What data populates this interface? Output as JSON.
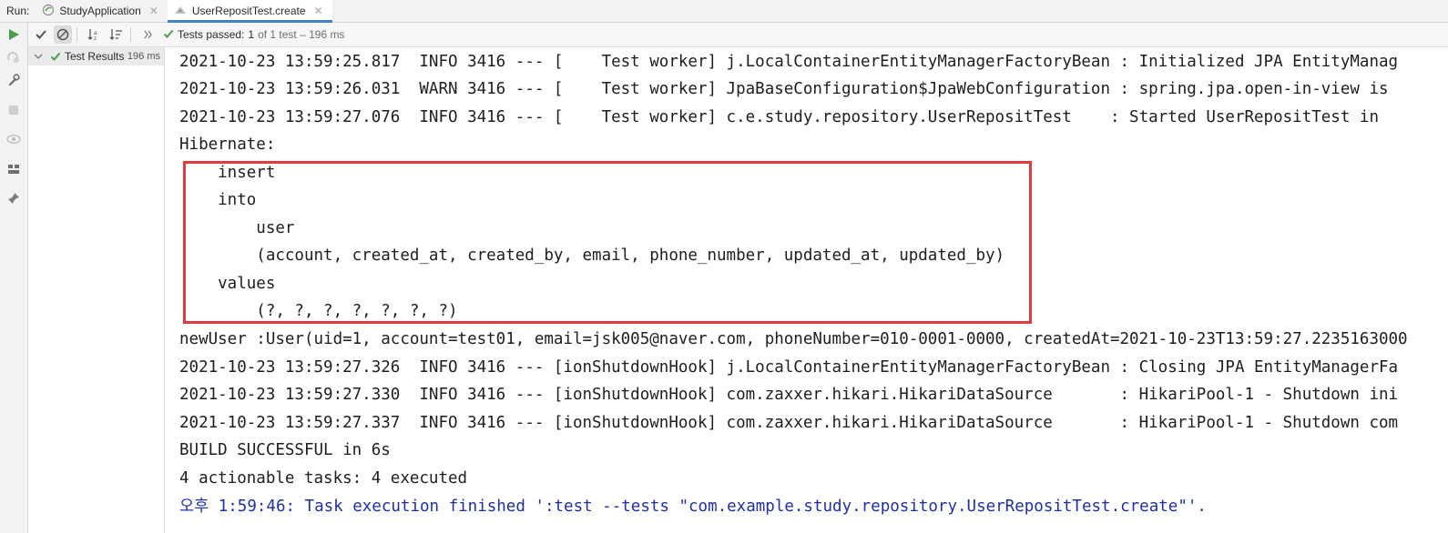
{
  "tabbar": {
    "run_label": "Run:",
    "tabs": [
      {
        "label": "StudyApplication"
      },
      {
        "label": "UserRepositTest.create"
      }
    ]
  },
  "toolbar": {
    "status_prefix": "Tests passed:",
    "status_count": "1",
    "status_detail": "of 1 test – 196 ms"
  },
  "tree": {
    "root": {
      "label": "Test Results",
      "time": "196 ms"
    }
  },
  "console": {
    "lines": [
      "2021-10-23 13:59:25.817  INFO 3416 --- [    Test worker] j.LocalContainerEntityManagerFactoryBean : Initialized JPA EntityManag",
      "2021-10-23 13:59:26.031  WARN 3416 --- [    Test worker] JpaBaseConfiguration$JpaWebConfiguration : spring.jpa.open-in-view is",
      "2021-10-23 13:59:27.076  INFO 3416 --- [    Test worker] c.e.study.repository.UserRepositTest    : Started UserRepositTest in",
      "Hibernate: ",
      "    insert ",
      "    into",
      "        user",
      "        (account, created_at, created_by, email, phone_number, updated_at, updated_by) ",
      "    values",
      "        (?, ?, ?, ?, ?, ?, ?)",
      "newUser :User(uid=1, account=test01, email=jsk005@naver.com, phoneNumber=010-0001-0000, createdAt=2021-10-23T13:59:27.2235163000",
      "2021-10-23 13:59:27.326  INFO 3416 --- [ionShutdownHook] j.LocalContainerEntityManagerFactoryBean : Closing JPA EntityManagerFa",
      "2021-10-23 13:59:27.330  INFO 3416 --- [ionShutdownHook] com.zaxxer.hikari.HikariDataSource       : HikariPool-1 - Shutdown ini",
      "2021-10-23 13:59:27.337  INFO 3416 --- [ionShutdownHook] com.zaxxer.hikari.HikariDataSource       : HikariPool-1 - Shutdown com",
      "BUILD SUCCESSFUL in 6s",
      "4 actionable tasks: 4 executed",
      "오후 1:59:46: Task execution finished ':test --tests \"com.example.study.repository.UserRepositTest.create\"'."
    ]
  },
  "colors": {
    "accent": "#4083c9",
    "pass_green": "#4a9e47",
    "highlight_red": "#e03c3c",
    "system_blue": "#1f2fa8"
  }
}
